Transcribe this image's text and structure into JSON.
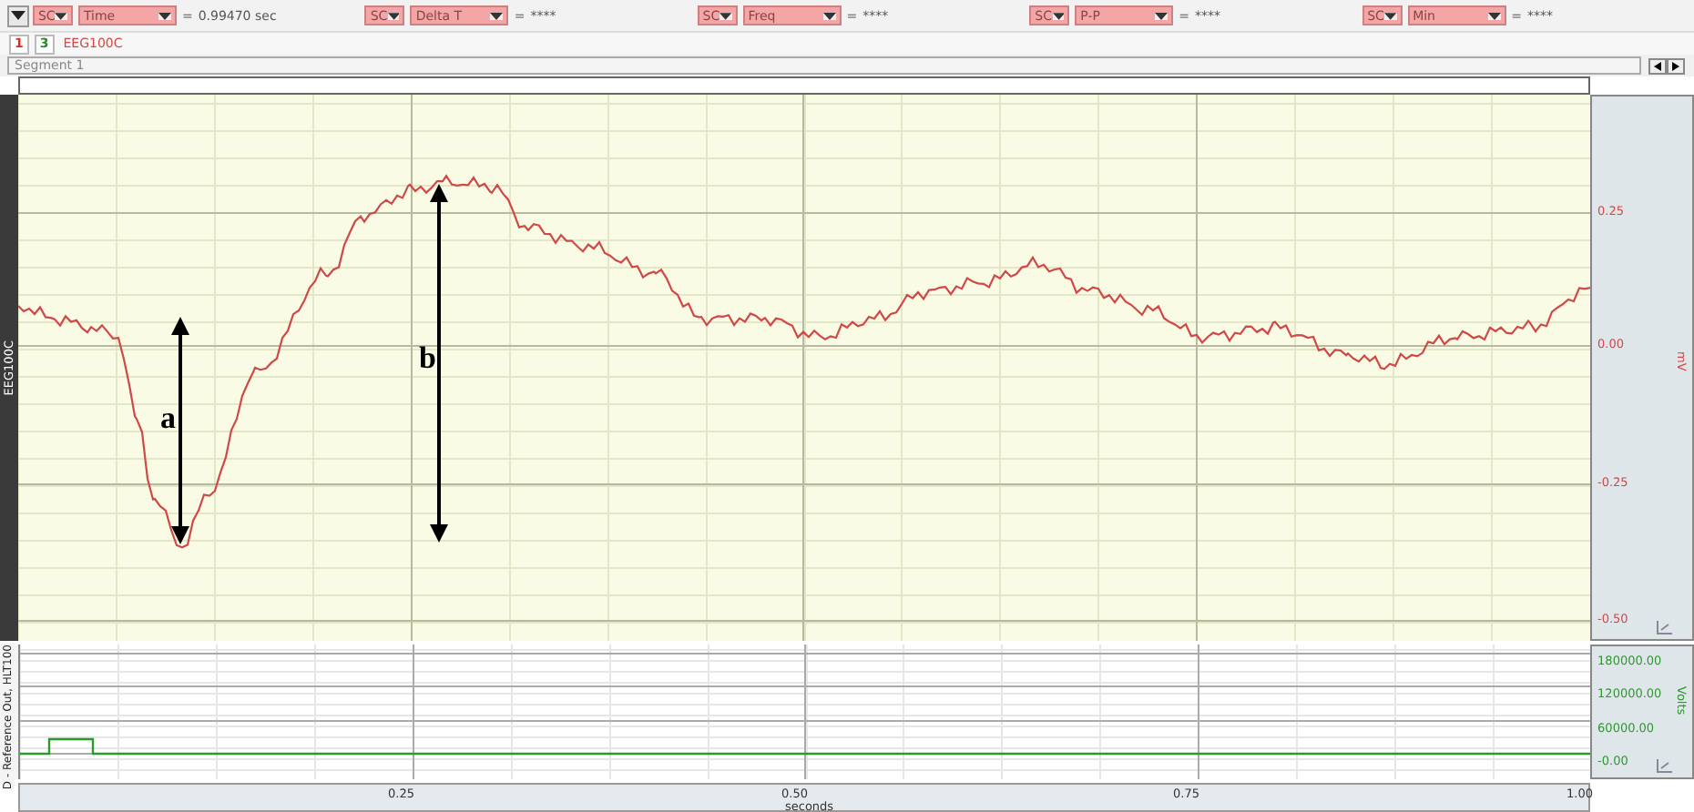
{
  "toolbar": {
    "measurements": [
      {
        "channel": "SC",
        "type": "Time",
        "equals": "=",
        "value": "0.99470 sec"
      },
      {
        "channel": "SC",
        "type": "Delta T",
        "equals": "=",
        "value": "****"
      },
      {
        "channel": "SC",
        "type": "Freq",
        "equals": "=",
        "value": "****"
      },
      {
        "channel": "SC",
        "type": "P-P",
        "equals": "=",
        "value": "****"
      },
      {
        "channel": "SC",
        "type": "Min",
        "equals": "=",
        "value": "****"
      }
    ]
  },
  "channel_tabs": [
    {
      "label": "1",
      "color": "#d03030"
    },
    {
      "label": "3",
      "color": "#2a8a2a"
    }
  ],
  "active_channel": "EEG100C",
  "segment": "Segment 1",
  "channels": [
    {
      "label": "EEG100C",
      "unit": "mV",
      "color": "#d04848",
      "yticks": [
        "0.25",
        "0.00",
        "-0.25",
        "-0.50"
      ]
    },
    {
      "label": "D - Reference Out, HLT100",
      "unit": "Volts",
      "color": "#2a9a2a",
      "yticks": [
        "180000.00",
        "120000.00",
        "60000.00",
        "-0.00"
      ]
    }
  ],
  "x_axis": {
    "ticks": [
      "0.25",
      "0.50",
      "0.75",
      "1.00"
    ],
    "label": "seconds"
  },
  "annotations": [
    {
      "label": "a"
    },
    {
      "label": "b"
    }
  ]
}
